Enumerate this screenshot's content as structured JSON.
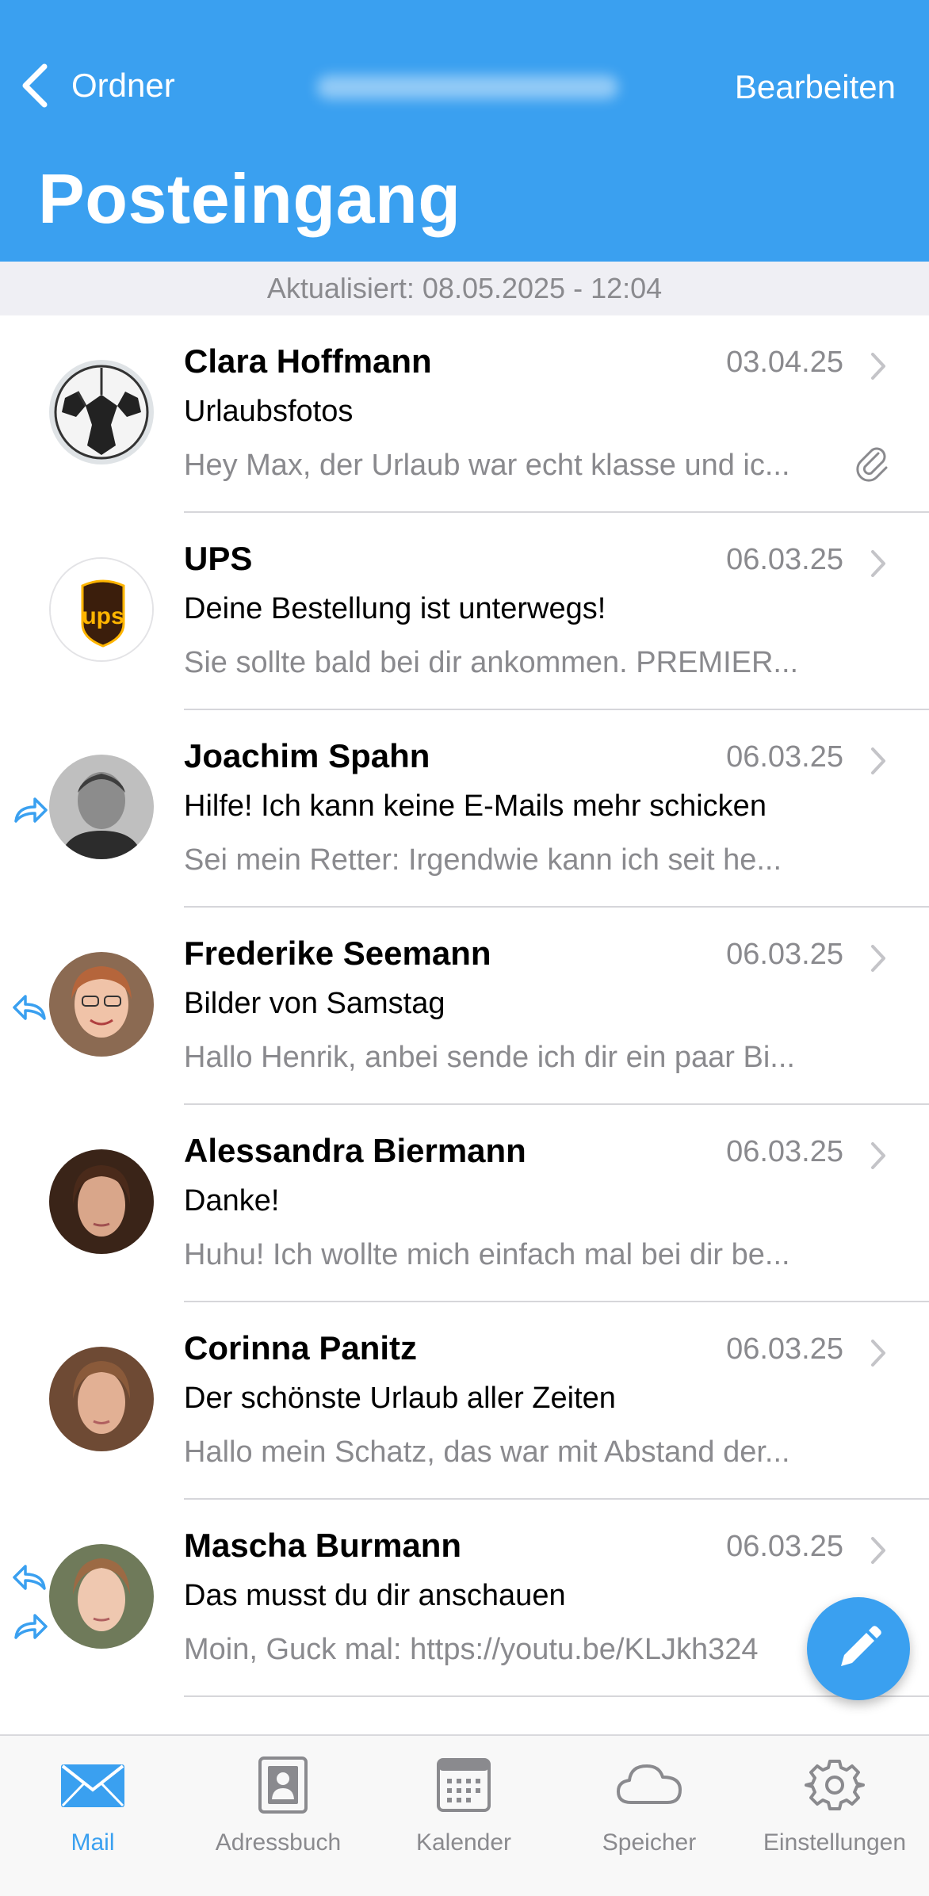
{
  "header": {
    "back_label": "Ordner",
    "edit_label": "Bearbeiten",
    "title": "Posteingang"
  },
  "updated_text": "Aktualisiert: 08.05.2025 - 12:04",
  "colors": {
    "accent": "#3aa0f0",
    "secondary_text": "#8a8a8e"
  },
  "messages": [
    {
      "sender": "Clara Hoffmann",
      "date": "03.04.25",
      "subject": "Urlaubsfotos",
      "preview": "Hey Max, der Urlaub war echt klasse und ic...",
      "attachment": true,
      "status": "none",
      "avatar": "soccer-ball"
    },
    {
      "sender": "UPS",
      "date": "06.03.25",
      "subject": "Deine Bestellung ist unterwegs!",
      "preview": "Sie sollte bald bei dir ankommen. PREMIER...",
      "attachment": false,
      "status": "none",
      "avatar": "ups-logo"
    },
    {
      "sender": "Joachim Spahn",
      "date": "06.03.25",
      "subject": "Hilfe! Ich kann keine E-Mails mehr schicken",
      "preview": "Sei mein Retter: Irgendwie kann ich seit he...",
      "attachment": false,
      "status": "forwarded",
      "avatar": "person-photo"
    },
    {
      "sender": "Frederike Seemann",
      "date": "06.03.25",
      "subject": "Bilder von Samstag",
      "preview": "Hallo Henrik, anbei sende ich dir ein paar Bi...",
      "attachment": false,
      "status": "replied",
      "avatar": "person-photo"
    },
    {
      "sender": "Alessandra Biermann",
      "date": "06.03.25",
      "subject": "Danke!",
      "preview": "Huhu! Ich wollte mich einfach mal bei dir be...",
      "attachment": false,
      "status": "none",
      "avatar": "person-photo"
    },
    {
      "sender": "Corinna Panitz",
      "date": "06.03.25",
      "subject": "Der schönste Urlaub aller Zeiten",
      "preview": "Hallo mein Schatz, das war mit Abstand der...",
      "attachment": false,
      "status": "none",
      "avatar": "person-photo"
    },
    {
      "sender": "Mascha Burmann",
      "date": "06.03.25",
      "subject": "Das musst du dir anschauen",
      "preview": "Moin, Guck mal: https://youtu.be/KLJkh324",
      "attachment": false,
      "status": "replied-forwarded",
      "avatar": "person-photo"
    }
  ],
  "tabs": [
    {
      "label": "Mail",
      "icon": "mail-icon",
      "active": true
    },
    {
      "label": "Adressbuch",
      "icon": "address-book-icon",
      "active": false
    },
    {
      "label": "Kalender",
      "icon": "calendar-icon",
      "active": false
    },
    {
      "label": "Speicher",
      "icon": "cloud-icon",
      "active": false
    },
    {
      "label": "Einstellungen",
      "icon": "gear-icon",
      "active": false
    }
  ],
  "fab_icon": "pencil-icon"
}
